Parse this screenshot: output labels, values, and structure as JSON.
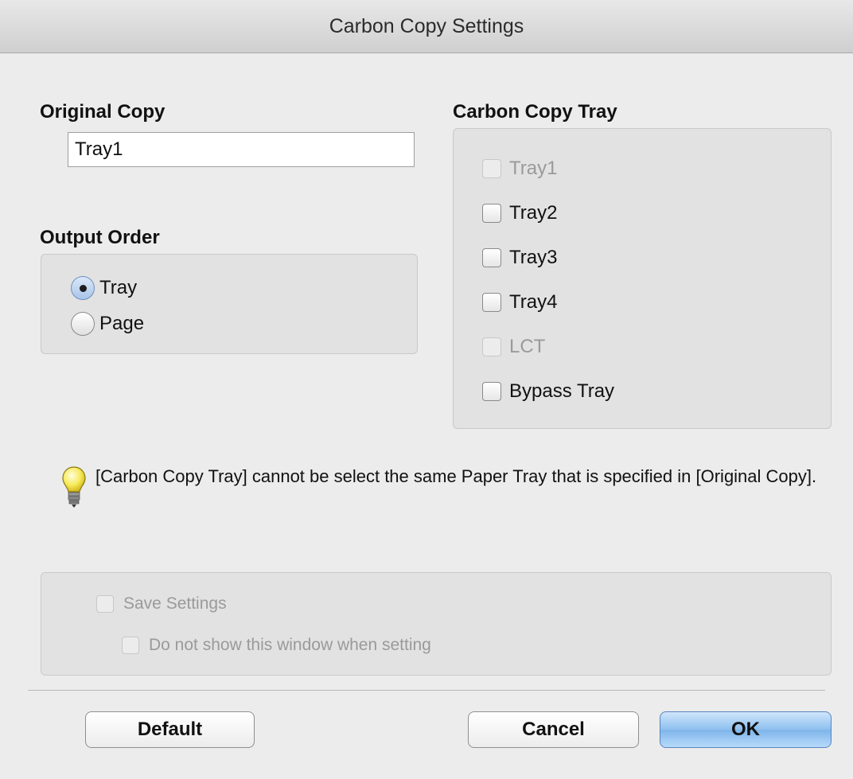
{
  "window": {
    "title": "Carbon Copy Settings"
  },
  "original_copy": {
    "label": "Original Copy",
    "value": "Tray1"
  },
  "output_order": {
    "label": "Output Order",
    "options": [
      {
        "label": "Tray",
        "checked": true
      },
      {
        "label": "Page",
        "checked": false
      }
    ]
  },
  "carbon_copy_tray": {
    "label": "Carbon Copy Tray",
    "items": [
      {
        "label": "Tray1",
        "enabled": false,
        "checked": false
      },
      {
        "label": "Tray2",
        "enabled": true,
        "checked": false
      },
      {
        "label": "Tray3",
        "enabled": true,
        "checked": false
      },
      {
        "label": "Tray4",
        "enabled": true,
        "checked": false
      },
      {
        "label": "LCT",
        "enabled": false,
        "checked": false
      },
      {
        "label": "Bypass Tray",
        "enabled": true,
        "checked": false
      }
    ]
  },
  "hint": {
    "icon": "lightbulb-icon",
    "text": "[Carbon Copy Tray] cannot be select the same Paper Tray that is specified in [Original Copy]."
  },
  "save_settings": {
    "label": "Save Settings",
    "enabled": false,
    "do_not_show_label": "Do not show this window when setting"
  },
  "buttons": {
    "default": "Default",
    "cancel": "Cancel",
    "ok": "OK"
  },
  "colors": {
    "primary_button": "#8ec0ef",
    "panel": "#e2e2e2",
    "disabled_text": "#9a9a9a"
  }
}
